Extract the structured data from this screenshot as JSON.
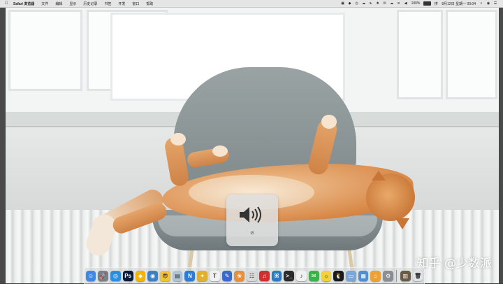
{
  "menubar": {
    "apple_icon": "apple-logo-icon",
    "app_name": "Safari 浏览器",
    "menus": [
      "文件",
      "编辑",
      "显示",
      "历史记录",
      "书签",
      "开发",
      "窗口",
      "帮助"
    ],
    "battery_percent": "100%",
    "datetime": "8月12日 星期一 00:04"
  },
  "volume_hud": {
    "speaker_icon": "speaker-volume-icon",
    "mute_glyph": "⊘"
  },
  "watermark": {
    "text": "知乎 @少数派"
  },
  "dock": {
    "apps": [
      {
        "icon": "finder-icon",
        "color": "#3d8ae6",
        "glyph": "☺"
      },
      {
        "icon": "launchpad-icon",
        "color": "#7a7f88",
        "glyph": "🚀"
      },
      {
        "icon": "safari-icon",
        "color": "#2a8fe0",
        "glyph": "◎"
      },
      {
        "icon": "photoshop-icon",
        "color": "#0a1a3a",
        "glyph": "Ps"
      },
      {
        "icon": "sketch-icon",
        "color": "#f4b400",
        "glyph": "◆"
      },
      {
        "icon": "chrome-icon",
        "color": "#3b82c4",
        "glyph": "◉"
      },
      {
        "icon": "emoji-app-icon",
        "color": "#f2c237",
        "glyph": "😎"
      },
      {
        "icon": "preview-icon",
        "color": "#b0c4d6",
        "glyph": "▤"
      },
      {
        "icon": "notes-app-icon",
        "color": "#2e7bd6",
        "glyph": "N"
      },
      {
        "icon": "butterfly-app-icon",
        "color": "#e0b030",
        "glyph": "✦"
      },
      {
        "icon": "typora-icon",
        "color": "#f0f0f0",
        "glyph": "T"
      },
      {
        "icon": "pen-app-icon",
        "color": "#3a6ad0",
        "glyph": "✎"
      },
      {
        "icon": "photos-icon",
        "color": "#e98f3a",
        "glyph": "❀"
      },
      {
        "icon": "contacts-icon",
        "color": "#d9d9d9",
        "glyph": "☷"
      },
      {
        "icon": "netease-music-icon",
        "color": "#d22e2e",
        "glyph": "♫"
      },
      {
        "icon": "vscode-icon",
        "color": "#2a7ac8",
        "glyph": "⌘"
      },
      {
        "icon": "terminal-icon",
        "color": "#2b2b2b",
        "glyph": ">_"
      },
      {
        "icon": "itunes-icon",
        "color": "#f0f0f0",
        "glyph": "♪"
      },
      {
        "icon": "wechat-icon",
        "color": "#3bb34a",
        "glyph": "✉"
      },
      {
        "icon": "lemon-app-icon",
        "color": "#f2d23a",
        "glyph": "☼"
      },
      {
        "icon": "qq-icon",
        "color": "#1a1a1a",
        "glyph": "🐧"
      },
      {
        "icon": "folder-icon",
        "color": "#7aa6dc",
        "glyph": "▭"
      },
      {
        "icon": "finder-window-icon",
        "color": "#4a8fd8",
        "glyph": "▦"
      },
      {
        "icon": "home-app-icon",
        "color": "#f0a030",
        "glyph": "⌂"
      },
      {
        "icon": "system-preferences-icon",
        "color": "#8a8d92",
        "glyph": "⚙"
      }
    ],
    "trailing": [
      {
        "icon": "downloads-stack-icon",
        "color": "#6b5a44",
        "glyph": "▥"
      },
      {
        "icon": "trash-icon",
        "color": "#dfe3e6",
        "glyph": "🗑"
      }
    ]
  }
}
